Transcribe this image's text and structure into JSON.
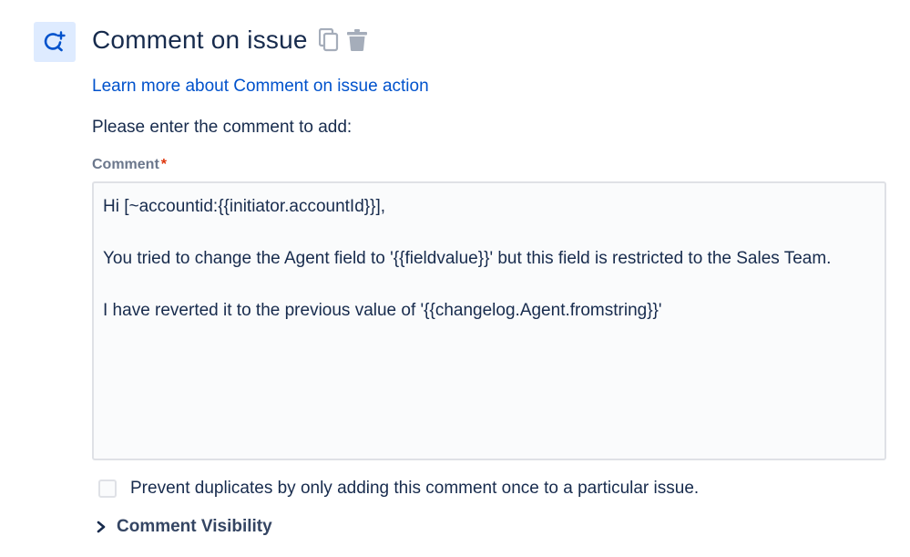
{
  "header": {
    "title": "Comment on issue",
    "action_icon": "comment-add-icon",
    "copy_icon": "copy-icon",
    "delete_icon": "trash-icon"
  },
  "learn_more": {
    "label": "Learn more about Comment on issue action"
  },
  "prompt": "Please enter the comment to add:",
  "comment_field": {
    "label": "Comment",
    "required_mark": "*",
    "lines": [
      "Hi [~accountid:{{initiator.accountId}}],",
      "",
      "You tried to change the Agent field to '{{fieldvalue}}' but this field is restricted to the Sales Team.",
      "",
      "I have reverted it to the previous value of '{{changelog.Agent.fromstring}}'"
    ]
  },
  "prevent_duplicates": {
    "label": "Prevent duplicates by only adding this comment once to a particular issue.",
    "checked": false
  },
  "visibility": {
    "label": "Comment Visibility",
    "icon": "chevron-right-icon"
  },
  "colors": {
    "link": "#0052cc",
    "accent_bg": "#deebff",
    "required": "#de350b",
    "text": "#172b4d"
  }
}
